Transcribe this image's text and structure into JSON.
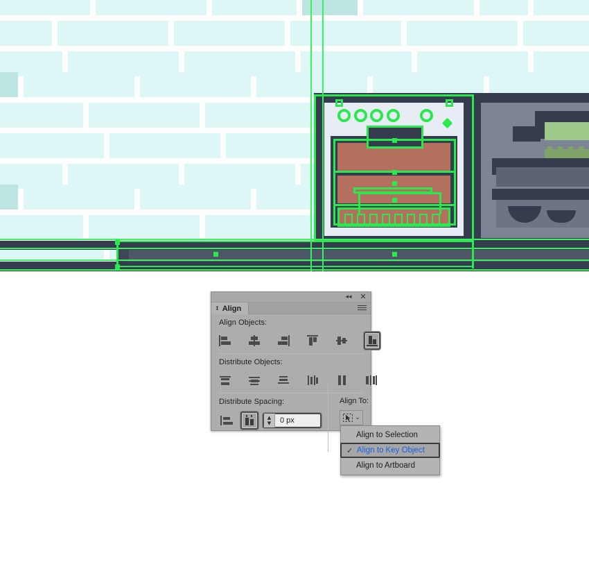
{
  "app": {
    "name": "Adobe Illustrator",
    "canvas_label": "artboard-canvas"
  },
  "panel": {
    "title": "Align",
    "tab_chevron_icon": "updown-chevron-icon",
    "collapse_icon": "double-chevron-left-icon",
    "close_icon": "close-icon",
    "menu_icon": "panel-menu-icon",
    "sections": {
      "align_objects": {
        "label": "Align Objects:",
        "buttons": [
          {
            "name": "horizontal-align-left",
            "selected": false
          },
          {
            "name": "horizontal-align-center",
            "selected": false
          },
          {
            "name": "horizontal-align-right",
            "selected": false
          },
          {
            "name": "vertical-align-top",
            "selected": false
          },
          {
            "name": "vertical-align-center",
            "selected": false
          },
          {
            "name": "vertical-align-bottom",
            "selected": true
          }
        ]
      },
      "distribute_objects": {
        "label": "Distribute Objects:",
        "buttons": [
          {
            "name": "vertical-distribute-top",
            "selected": false
          },
          {
            "name": "vertical-distribute-center",
            "selected": false
          },
          {
            "name": "vertical-distribute-bottom",
            "selected": false
          },
          {
            "name": "horizontal-distribute-left",
            "selected": false
          },
          {
            "name": "horizontal-distribute-center",
            "selected": false
          },
          {
            "name": "horizontal-distribute-right",
            "selected": false
          }
        ]
      },
      "distribute_spacing": {
        "label": "Distribute Spacing:",
        "buttons": [
          {
            "name": "vertical-distribute-spacing",
            "selected": false
          },
          {
            "name": "horizontal-distribute-spacing",
            "selected": true
          }
        ],
        "value": "0 px",
        "placeholder": "0 px",
        "stepper_up": "▲",
        "stepper_down": "▼"
      },
      "align_to": {
        "label": "Align To:",
        "button_icon": "align-to-key-object-icon",
        "chevron": "⌄",
        "selected": "Align to Key Object"
      }
    }
  },
  "alignto_menu": {
    "name": "align-to-dropdown-menu",
    "check_glyph": "✓",
    "items": [
      {
        "label": "Align to Selection",
        "checked": false,
        "highlighted": false
      },
      {
        "label": "Align to Key Object",
        "checked": true,
        "highlighted": true
      },
      {
        "label": "Align to Artboard",
        "checked": false,
        "highlighted": false
      }
    ]
  },
  "colors": {
    "selection_green": "#2ce84f",
    "guide_green": "#3df05e",
    "tile_light": "#ddf6f6",
    "tile_dark": "#bde5e2",
    "counter_dark": "#343c4e",
    "counter_mid": "#4e5768",
    "stove_body": "#e8ecf5",
    "oven_red": "#b3705f",
    "cabinet_gray": "#7d8494",
    "plant_green": "#9ec98a",
    "panel_bg": "#adadad",
    "menu_highlight_text": "#1a62e0"
  }
}
